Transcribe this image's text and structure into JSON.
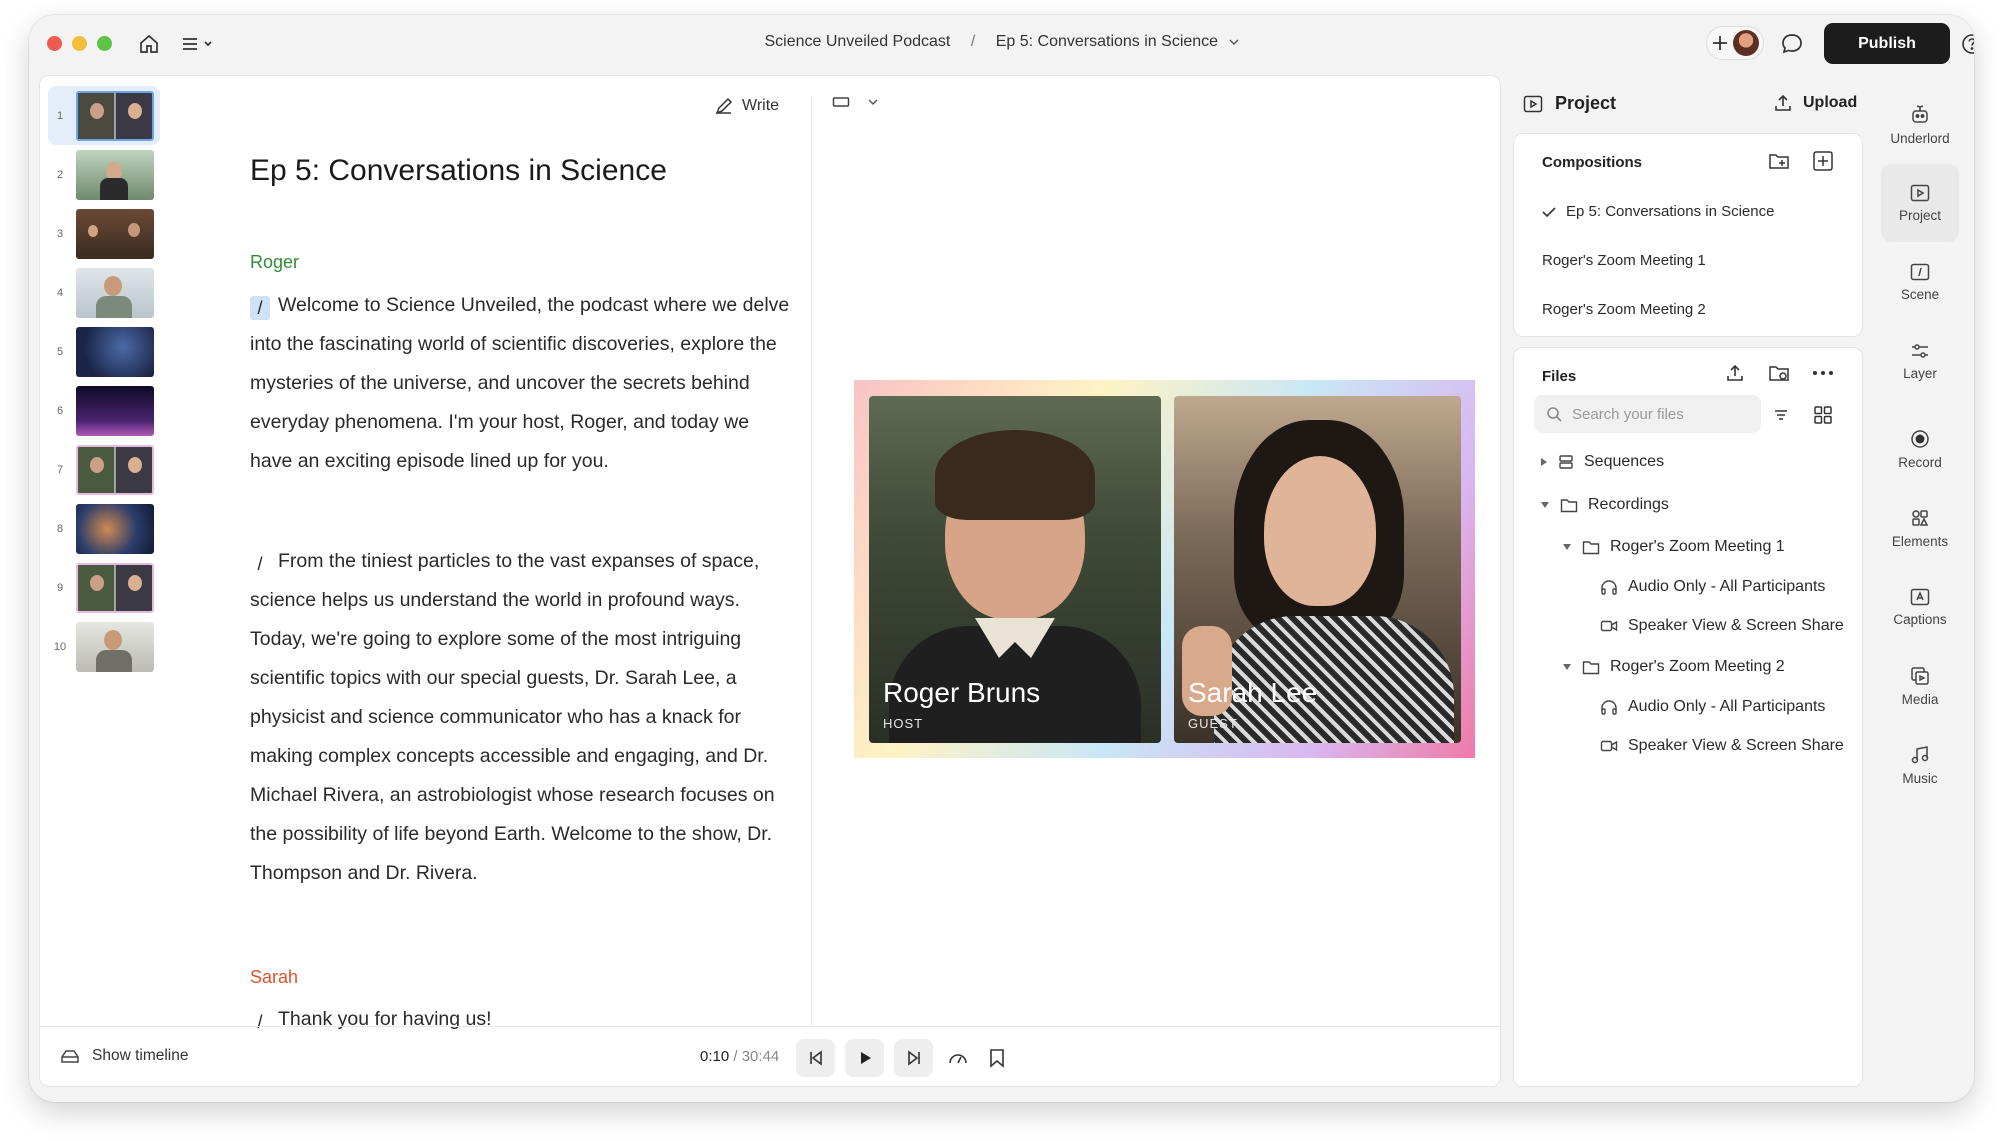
{
  "titlebar": {
    "breadcrumb_project": "Science Unveiled Podcast",
    "breadcrumb_separator": "/",
    "breadcrumb_composition": "Ep 5: Conversations in Science",
    "publish_label": "Publish"
  },
  "thumbnails": [
    "1",
    "2",
    "3",
    "4",
    "5",
    "6",
    "7",
    "8",
    "9",
    "10"
  ],
  "script": {
    "write_label": "Write",
    "title": "Ep 5: Conversations in Science",
    "blocks": [
      {
        "speaker": "Roger",
        "speaker_color": "#2e8b3a",
        "text": "Welcome to Science Unveiled, the podcast where we delve into the fascinating world of scientific discoveries, explore the mysteries of the universe, and uncover the secrets behind everyday phenomena. I'm your host, Roger, and today we have an exciting episode lined up for you."
      },
      {
        "speaker": "",
        "text": "From the tiniest particles to the vast expanses of space, science helps us understand the world in profound ways. Today, we're going to explore some of the most intriguing scientific topics with our special guests, Dr. Sarah Lee, a physicist and science communicator who has a knack for making complex concepts accessible and engaging, and Dr. Michael Rivera, an astrobiologist whose research focuses on the possibility of life beyond Earth. Welcome to the show, Dr. Thompson and Dr. Rivera."
      },
      {
        "speaker": "Sarah",
        "speaker_color": "#e0532a",
        "text": "Thank you for having us!"
      }
    ]
  },
  "preview": {
    "host": {
      "name": "Roger  Bruns",
      "role": "HOST"
    },
    "guest": {
      "name": "Sarah  Lee",
      "role": "GUEST"
    }
  },
  "bottom": {
    "show_timeline": "Show timeline",
    "current_time": "0:10",
    "time_separator": " / ",
    "duration": "30:44"
  },
  "project_panel": {
    "title": "Project",
    "upload_label": "Upload",
    "compositions_title": "Compositions",
    "compositions": [
      "Ep 5: Conversations in Science",
      "Roger's Zoom Meeting 1",
      "Roger's Zoom Meeting 2"
    ],
    "files_title": "Files",
    "search_placeholder": "Search your files",
    "tree": {
      "sequences": "Sequences",
      "recordings": "Recordings",
      "meeting1": "Roger's Zoom Meeting 1",
      "m1_audio": "Audio Only - All Participants",
      "m1_video": "Speaker View & Screen Share",
      "meeting2": "Roger's Zoom Meeting 2",
      "m2_audio": "Audio Only - All Participants",
      "m2_video": "Speaker View & Screen Share"
    }
  },
  "rail": [
    "Underlord",
    "Project",
    "Scene",
    "Layer",
    "Record",
    "Elements",
    "Captions",
    "Media",
    "Music"
  ]
}
